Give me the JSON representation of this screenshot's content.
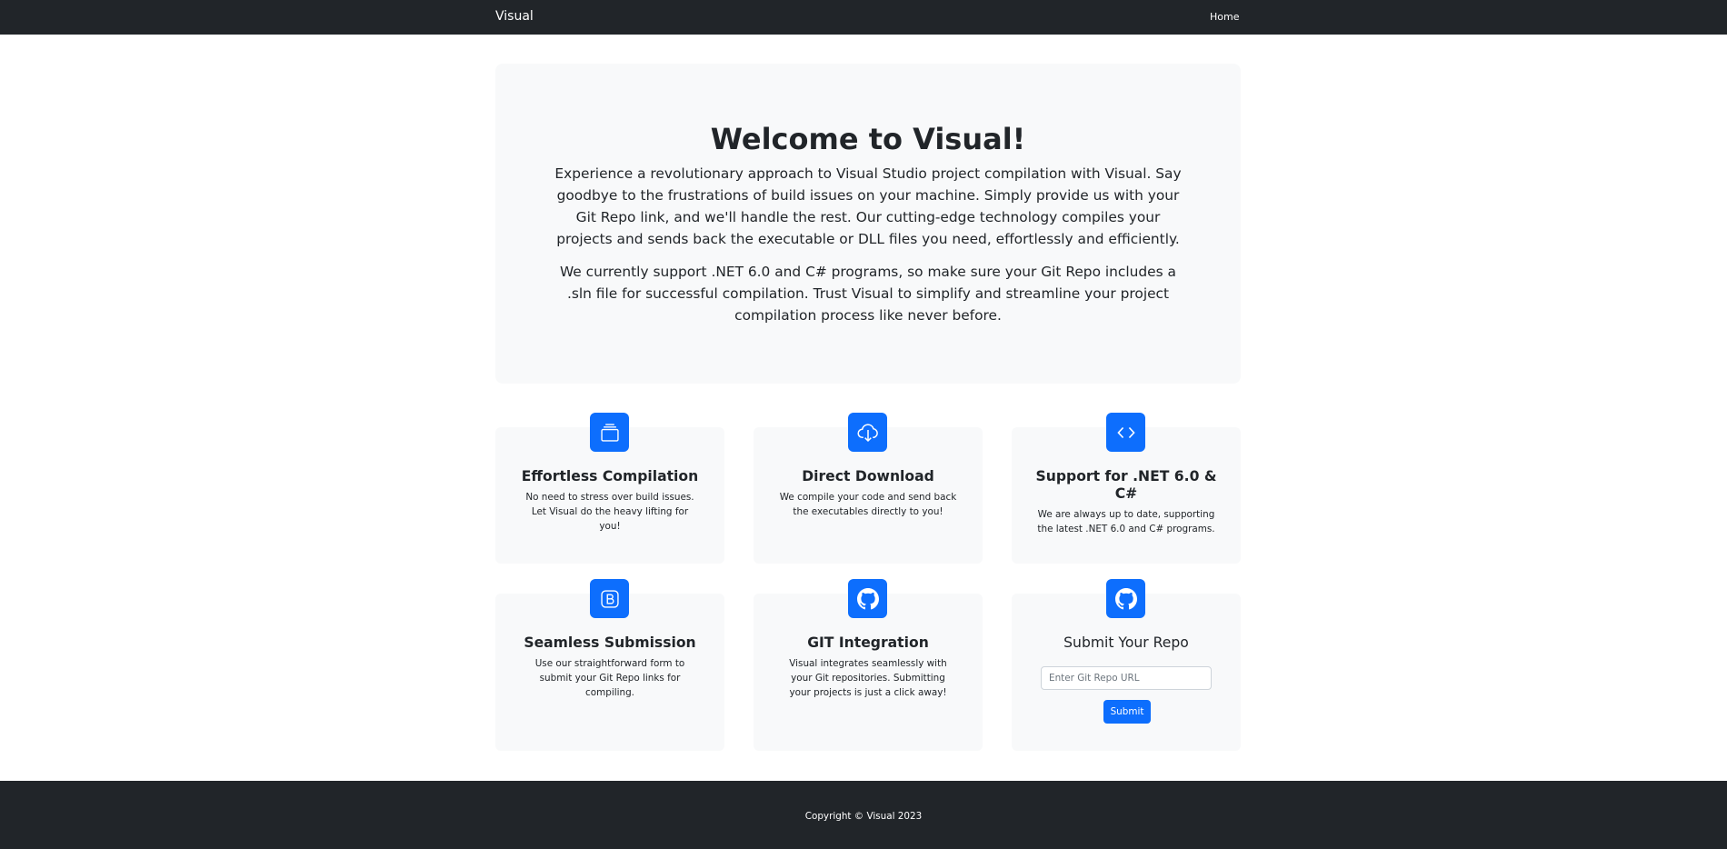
{
  "navbar": {
    "brand": "Visual",
    "links": [
      {
        "label": "Home"
      }
    ]
  },
  "hero": {
    "title": "Welcome to Visual!",
    "paragraph1": "Experience a revolutionary approach to Visual Studio project compilation with Visual. Say goodbye to the frustrations of build issues on your machine. Simply provide us with your Git Repo link, and we'll handle the rest. Our cutting-edge technology compiles your projects and sends back the executable or DLL files you need, effortlessly and efficiently.",
    "paragraph2": "We currently support .NET 6.0 and C# programs, so make sure your Git Repo includes a .sln file for successful compilation. Trust Visual to simplify and streamline your project compilation process like never before."
  },
  "features": [
    {
      "icon": "collection-icon",
      "title": "Effortless Compilation",
      "text": "No need to stress over build issues. Let Visual do the heavy lifting for you!"
    },
    {
      "icon": "cloud-download-icon",
      "title": "Direct Download",
      "text": "We compile your code and send back the executables directly to you!"
    },
    {
      "icon": "code-icon",
      "title": "Support for .NET 6.0 & C#",
      "text": "We are always up to date, supporting the latest .NET 6.0 and C# programs."
    },
    {
      "icon": "bootstrap-icon",
      "title": "Seamless Submission",
      "text": "Use our straightforward form to submit your Git Repo links for compiling."
    },
    {
      "icon": "github-icon",
      "title": "GIT Integration",
      "text": "Visual integrates seamlessly with your Git repositories. Submitting your projects is just a click away!"
    }
  ],
  "submit_form": {
    "icon": "github-icon",
    "title": "Submit Your Repo",
    "input_value": "",
    "input_placeholder": "Enter Git Repo URL",
    "button_label": "Submit"
  },
  "footer": {
    "copyright": "Copyright © Visual 2023"
  },
  "colors": {
    "navbar_bg": "#212529",
    "accent": "#0d6efd",
    "card_bg": "#f8f9fa",
    "footer_bg": "#212529"
  }
}
